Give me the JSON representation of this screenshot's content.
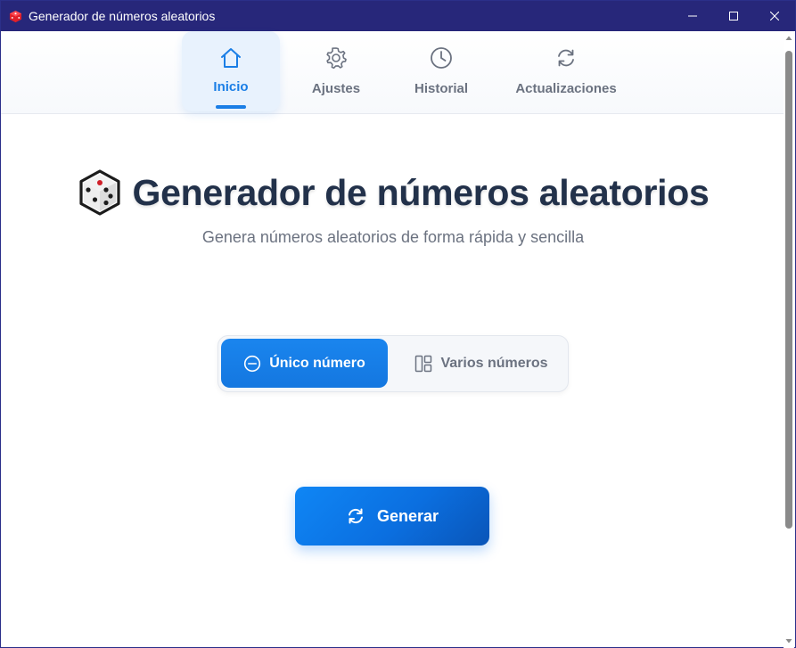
{
  "window": {
    "title": "Generador de números aleatorios"
  },
  "nav": {
    "tabs": [
      {
        "label": "Inicio",
        "icon": "home-icon",
        "active": true
      },
      {
        "label": "Ajustes",
        "icon": "gear-icon",
        "active": false
      },
      {
        "label": "Historial",
        "icon": "clock-icon",
        "active": false
      },
      {
        "label": "Actualizaciones",
        "icon": "refresh-icon",
        "active": false
      }
    ]
  },
  "main": {
    "title": "Generador de números aleatorios",
    "subtitle": "Genera números aleatorios de forma rápida y sencilla",
    "mode": {
      "single_label": "Único número",
      "multiple_label": "Varios números",
      "selected": "single"
    },
    "generate_label": "Generar"
  },
  "colors": {
    "titlebar": "#27277a",
    "accent": "#1a7ee6",
    "heading": "#22314a",
    "muted": "#6b7280"
  }
}
